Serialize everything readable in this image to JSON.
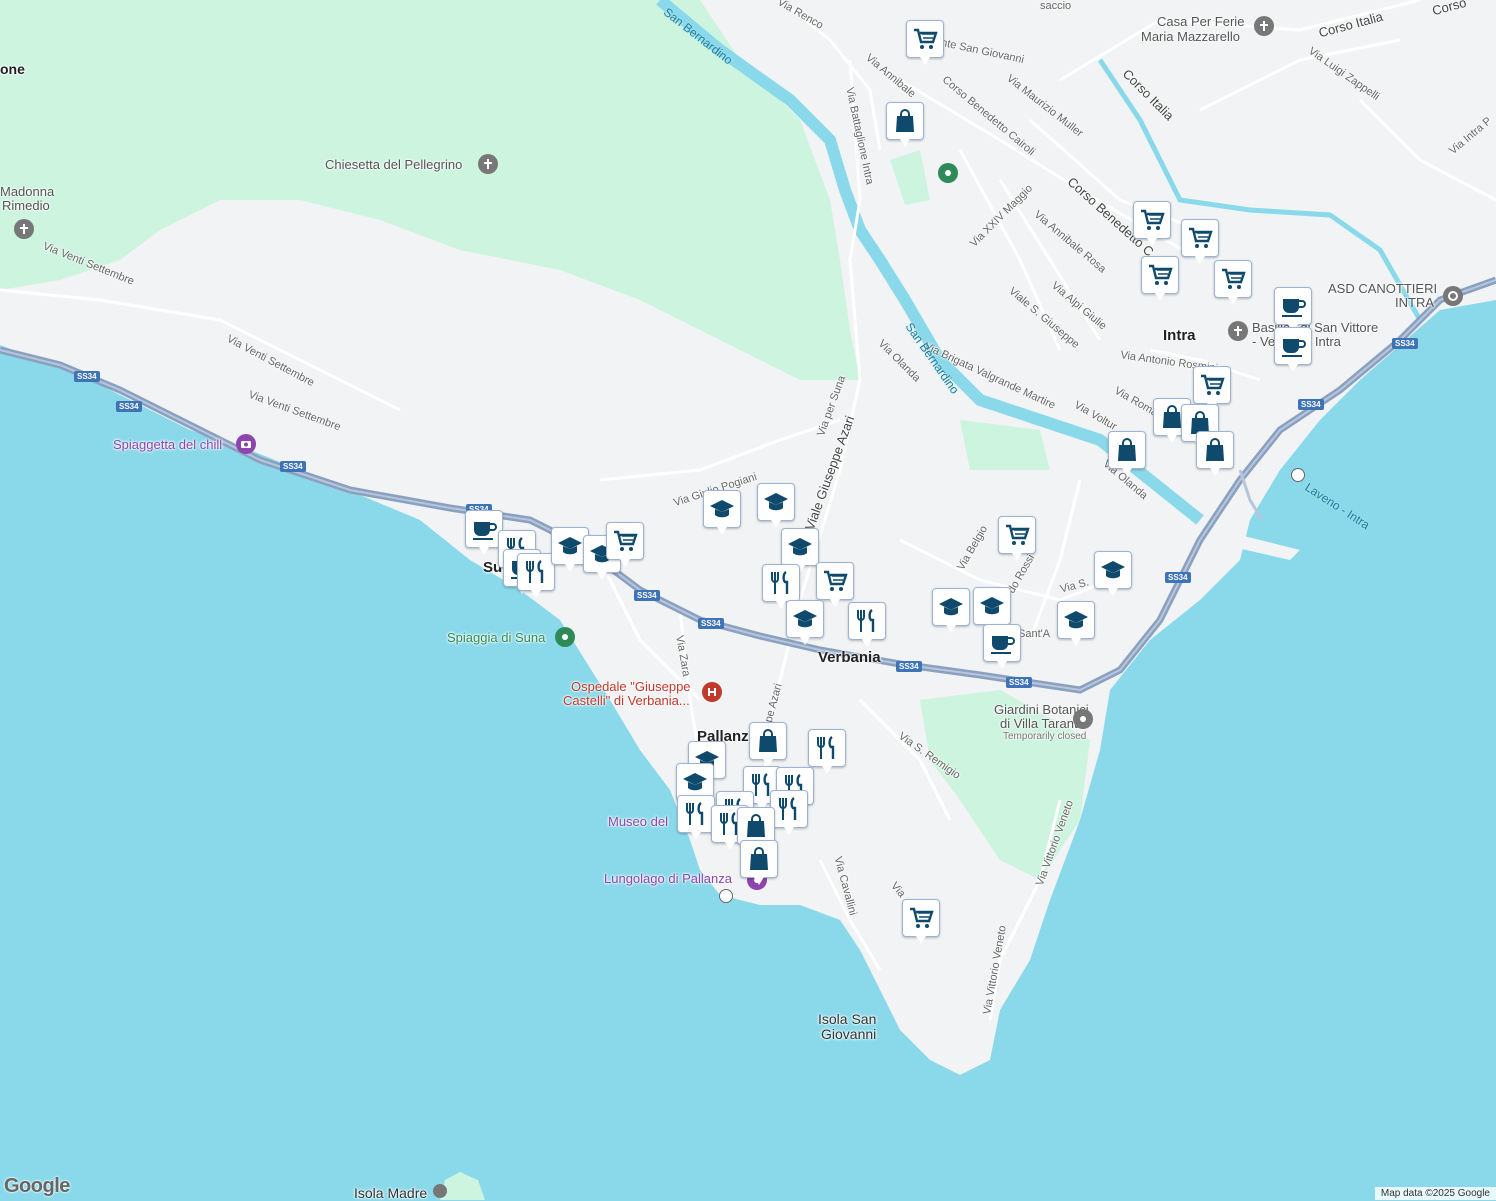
{
  "map": {
    "attribution": "Map data ©2025 Google",
    "logo": "Google",
    "colors": {
      "water": "#8ad9ea",
      "land": "#f1f3f4",
      "park": "#cdf4df",
      "river": "#8ad9ea",
      "highway": "#8aa0c0",
      "pin_icon": "#0f4a6c",
      "pin_border": "#9bb4d6",
      "poi_purple": "#8e44ad",
      "poi_red": "#c0392b",
      "poi_green": "#2e8b57",
      "poi_gray": "#777777"
    }
  },
  "labels": {
    "towns": {
      "verbania": "Verbania",
      "intra": "Intra",
      "pallanza": "Pallanza",
      "suna": "Suna",
      "one_fragment": "one"
    },
    "pois": {
      "chiesetta": "Chiesetta del Pellegrino",
      "madonna_1": "Madonna",
      "madonna_2": "Rimedio",
      "casa_ferie_1": "Casa Per Ferie",
      "casa_ferie_2": "Maria Mazzarello",
      "canottieri_1": "ASD CANOTTIERI",
      "canottieri_2": "INTRA",
      "basilica_1": "Basilica di San Vittore",
      "basilica_2": "- Verbania Intra",
      "spiaggetta": "Spiaggetta del chill",
      "spiaggia_suna": "Spiaggia di Suna",
      "ospedale_1": "Ospedale \"Giuseppe",
      "ospedale_2": "Castelli\" di Verbania...",
      "giardini_1": "Giardini Botanici",
      "giardini_2": "di Villa Taranto",
      "giardini_status": "Temporarily closed",
      "museo": "Museo del",
      "lungolago": "Lungolago di Pallanza",
      "laveno": "Laveno - Intra",
      "isola_sg_1": "Isola San",
      "isola_sg_2": "Giovanni",
      "isola_madre": "Isola Madre"
    },
    "roads": {
      "via_renco": "Via Renco",
      "ponte_sg": "Ponte San Giovanni",
      "via_annibale_1": "Via Annibale",
      "via_battaglione": "Via Battaglione Intra",
      "corso_cairoli": "Corso Benedetto Cairoli",
      "via_muller": "Via Maurizio Muller",
      "corso_italia_1": "Corso Italia",
      "corso_italia_2": "Corso Italia",
      "via_zappelli": "Via Luigi Zappelli",
      "via_intra": "Via Intra P",
      "corso_benedetto_c": "Corso Benedetto C",
      "via_xxiv_maggio": "Via XXIV Maggio",
      "via_annibale_rosa": "Via Annibale Rosa",
      "via_alpi_giulie": "Via Alpi Giulie",
      "viale_s_giuseppe": "Viale S. Giuseppe",
      "via_antonio_rosmini": "Via Antonio Rosmini",
      "via_olanda_1": "Via Olanda",
      "via_olanda_2": "Via Olanda",
      "via_brigata": "Via Brigata Valgrande Martire",
      "via_volturno": "Via Voltur",
      "via_roma": "Via Roma",
      "via_venti_1": "Via Venti Settembre",
      "via_venti_2": "Via Venti Settembre",
      "via_venti_3": "Via Venti Settembre",
      "via_giulio_pogiani": "Via Giulio Pogiani",
      "via_per_suna": "Via per Suna",
      "viale_azari": "Viale Giuseppe Azari",
      "via_belgio": "Via Belgio",
      "via_rossi": "do Rossi",
      "via_s": "Via S.",
      "sant_a": "Sant'A",
      "via_zara": "Via Zara",
      "azari_2": "ppe Azari",
      "via_s_remigio": "Via S. Remigio",
      "via_vittorio_veneto_1": "Via Vittorio Veneto",
      "via_vittorio_veneto_2": "Via Vittorio Veneto",
      "via_cavallini": "Via Cavallini",
      "via_trunc": "Via",
      "via_saccio": "saccio",
      "corso_frag": "Corso"
    },
    "water": {
      "san_bernardino_1": "San Bernardino",
      "san_bernardino_2": "San Bernardino"
    },
    "shield": "SS34"
  },
  "pins": [
    {
      "icon": "cart"
    },
    {
      "icon": "bag"
    },
    {
      "icon": "cart"
    },
    {
      "icon": "cart"
    },
    {
      "icon": "cart"
    },
    {
      "icon": "cart"
    },
    {
      "icon": "coffee"
    },
    {
      "icon": "coffee"
    },
    {
      "icon": "cart"
    },
    {
      "icon": "bag"
    },
    {
      "icon": "bag"
    },
    {
      "icon": "bag"
    },
    {
      "icon": "bag"
    },
    {
      "icon": "coffee"
    },
    {
      "icon": "fork"
    },
    {
      "icon": "coffee"
    },
    {
      "icon": "fork"
    },
    {
      "icon": "grad"
    },
    {
      "icon": "grad"
    },
    {
      "icon": "cart"
    },
    {
      "icon": "grad"
    },
    {
      "icon": "grad"
    },
    {
      "icon": "grad"
    },
    {
      "icon": "fork"
    },
    {
      "icon": "cart"
    },
    {
      "icon": "grad"
    },
    {
      "icon": "fork"
    },
    {
      "icon": "cart"
    },
    {
      "icon": "grad"
    },
    {
      "icon": "grad"
    },
    {
      "icon": "grad"
    },
    {
      "icon": "grad"
    },
    {
      "icon": "coffee"
    },
    {
      "icon": "bag"
    },
    {
      "icon": "fork"
    },
    {
      "icon": "grad"
    },
    {
      "icon": "grad"
    },
    {
      "icon": "fork"
    },
    {
      "icon": "fork"
    },
    {
      "icon": "fork"
    },
    {
      "icon": "fork"
    },
    {
      "icon": "fork"
    },
    {
      "icon": "fork"
    },
    {
      "icon": "bag"
    },
    {
      "icon": "bag"
    },
    {
      "icon": "cart"
    }
  ]
}
